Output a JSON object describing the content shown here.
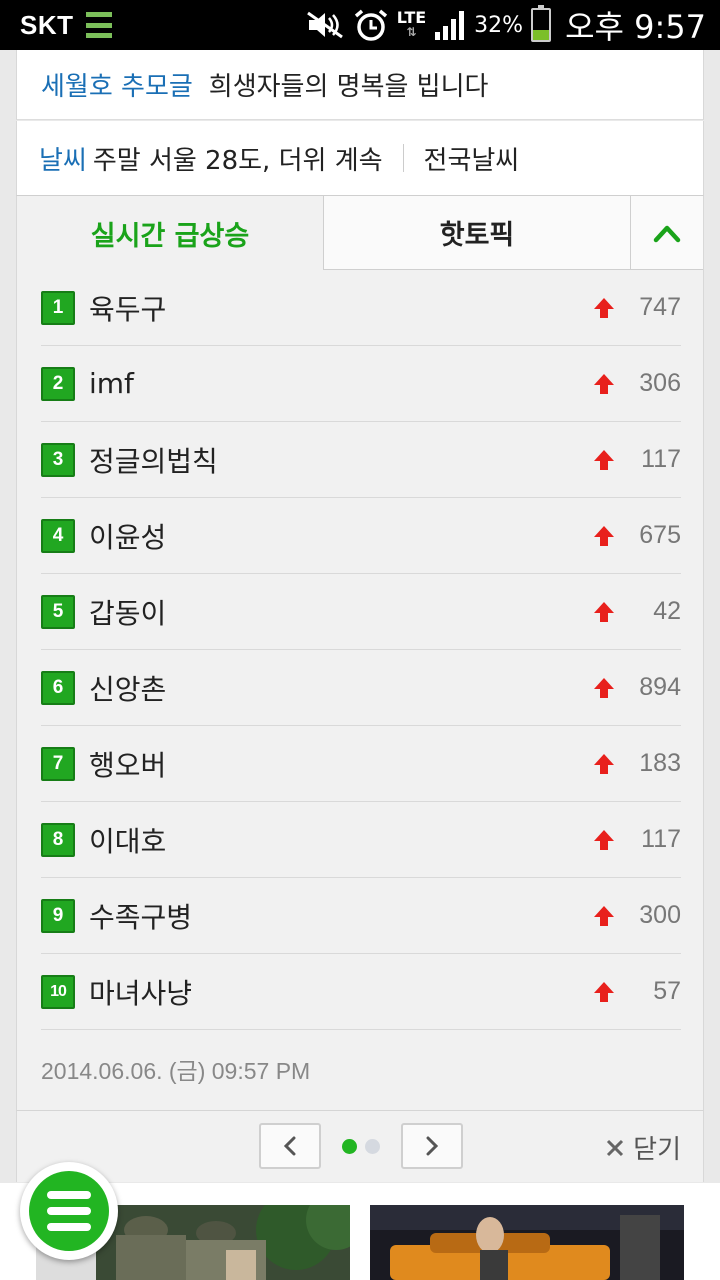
{
  "status_bar": {
    "carrier": "SKT",
    "network": "LTE",
    "battery": "32%",
    "battery_level": 0.32,
    "time": "오후 9:57"
  },
  "memorial": {
    "link": "세월호 추모글",
    "text": "희생자들의 명복을 빕니다"
  },
  "weather": {
    "label": "날씨",
    "text": "주말 서울 28도, 더위 계속",
    "all_link": "전국날씨"
  },
  "tabs": {
    "active": "실시간 급상승",
    "inactive": "핫토픽",
    "collapse_icon": "chevron-up-icon"
  },
  "ranking": [
    {
      "rank": "1",
      "keyword": "육두구",
      "change": "747",
      "trend": "up"
    },
    {
      "rank": "2",
      "keyword": "imf",
      "change": "306",
      "trend": "up"
    },
    {
      "rank": "3",
      "keyword": "정글의법칙",
      "change": "117",
      "trend": "up"
    },
    {
      "rank": "4",
      "keyword": "이윤성",
      "change": "675",
      "trend": "up"
    },
    {
      "rank": "5",
      "keyword": "갑동이",
      "change": "42",
      "trend": "up"
    },
    {
      "rank": "6",
      "keyword": "신앙촌",
      "change": "894",
      "trend": "up"
    },
    {
      "rank": "7",
      "keyword": "행오버",
      "change": "183",
      "trend": "up"
    },
    {
      "rank": "8",
      "keyword": "이대호",
      "change": "117",
      "trend": "up"
    },
    {
      "rank": "9",
      "keyword": "수족구병",
      "change": "300",
      "trend": "up"
    },
    {
      "rank": "10",
      "keyword": "마녀사냥",
      "change": "57",
      "trend": "up"
    }
  ],
  "timestamp": "2014.06.06. (금) 09:57 PM",
  "pager": {
    "current_page": 1,
    "total_pages": 2,
    "close_label": "닫기"
  },
  "colors": {
    "accent_green": "#21a721",
    "link_blue": "#1a6fb5",
    "up_red": "#e8201c"
  }
}
